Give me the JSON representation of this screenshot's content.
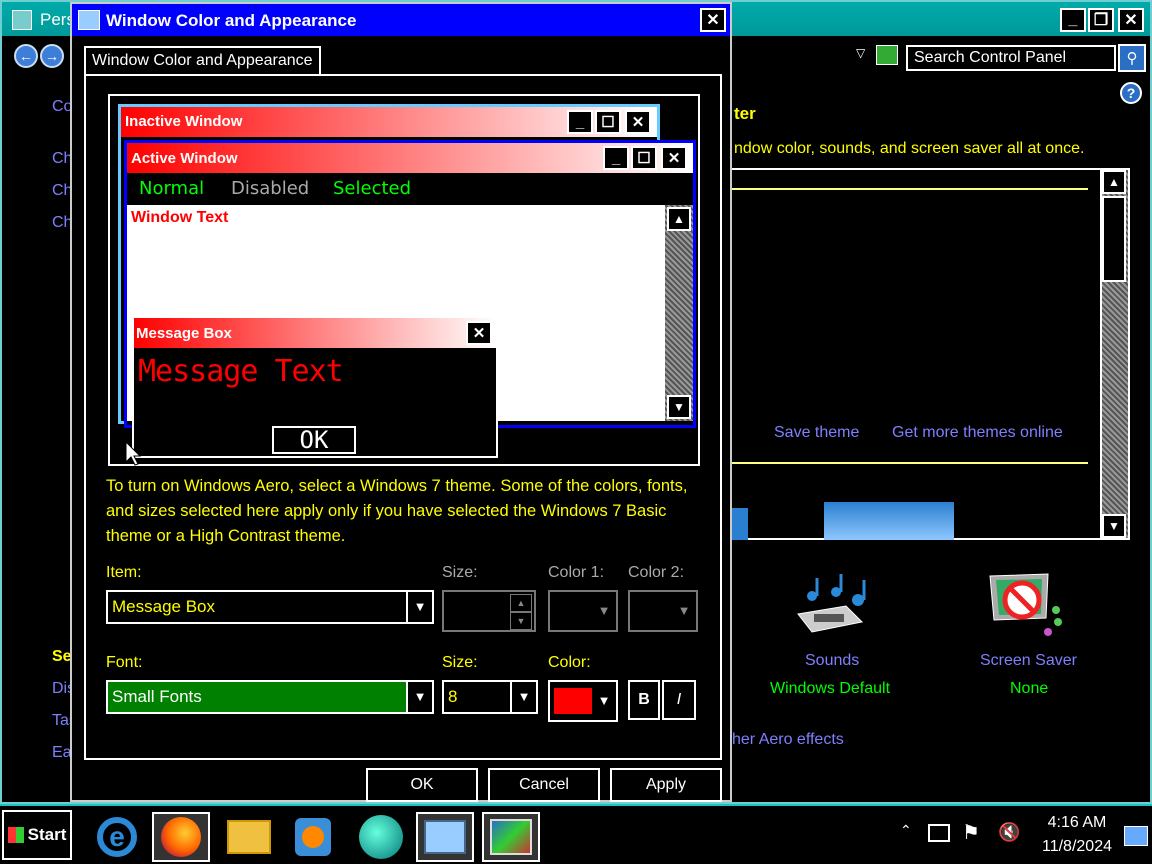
{
  "background_window": {
    "title": "Pers",
    "search_placeholder": "Search Control Panel",
    "left_nav": [
      "Co",
      "Ch",
      "Ch",
      "Ch"
    ],
    "see_also_heading": "Se",
    "see_also": [
      "Dis",
      "Tas",
      "Ea"
    ],
    "heading": "ter",
    "subheading": "ndow color, sounds, and screen saver all at once.",
    "save_theme": "Save theme",
    "get_more_themes": "Get more themes online",
    "sounds_label": "Sounds",
    "sounds_value": "Windows Default",
    "screensaver_label": "Screen Saver",
    "screensaver_value": "None",
    "aero_link": "her Aero effects"
  },
  "dialog": {
    "title": "Window Color and Appearance",
    "tab_label": "Window Color and Appearance",
    "preview": {
      "inactive_title": "Inactive Window",
      "active_title": "Active Window",
      "menu_normal": "Normal",
      "menu_disabled": "Disabled",
      "menu_selected": "Selected",
      "window_text": "Window Text",
      "msgbox_title": "Message Box",
      "msgbox_text": "Message Text",
      "ok_label": "OK"
    },
    "description": "To turn on Windows Aero, select a Windows 7 theme.  Some of the colors, fonts, and sizes selected here apply only if you have selected the Windows 7 Basic theme or a High Contrast theme.",
    "item_label": "Item:",
    "item_value": "Message Box",
    "size_label": "Size:",
    "color1_label": "Color 1:",
    "color2_label": "Color 2:",
    "font_label": "Font:",
    "font_value": "Small Fonts",
    "font_size_label": "Size:",
    "font_size_value": "8",
    "color_label": "Color:",
    "color_value": "#ff0000",
    "bold_label": "B",
    "italic_label": "I",
    "ok_button": "OK",
    "cancel_button": "Cancel",
    "apply_button": "Apply"
  },
  "taskbar": {
    "start_label": "Start",
    "time": "4:16 AM",
    "date": "11/8/2024"
  },
  "colors": {
    "title_active": "#0000ff",
    "highlight_text": "#ffff00",
    "link": "#7f7fff",
    "green_text": "#00ff00",
    "font_combo_bg": "#008000"
  }
}
